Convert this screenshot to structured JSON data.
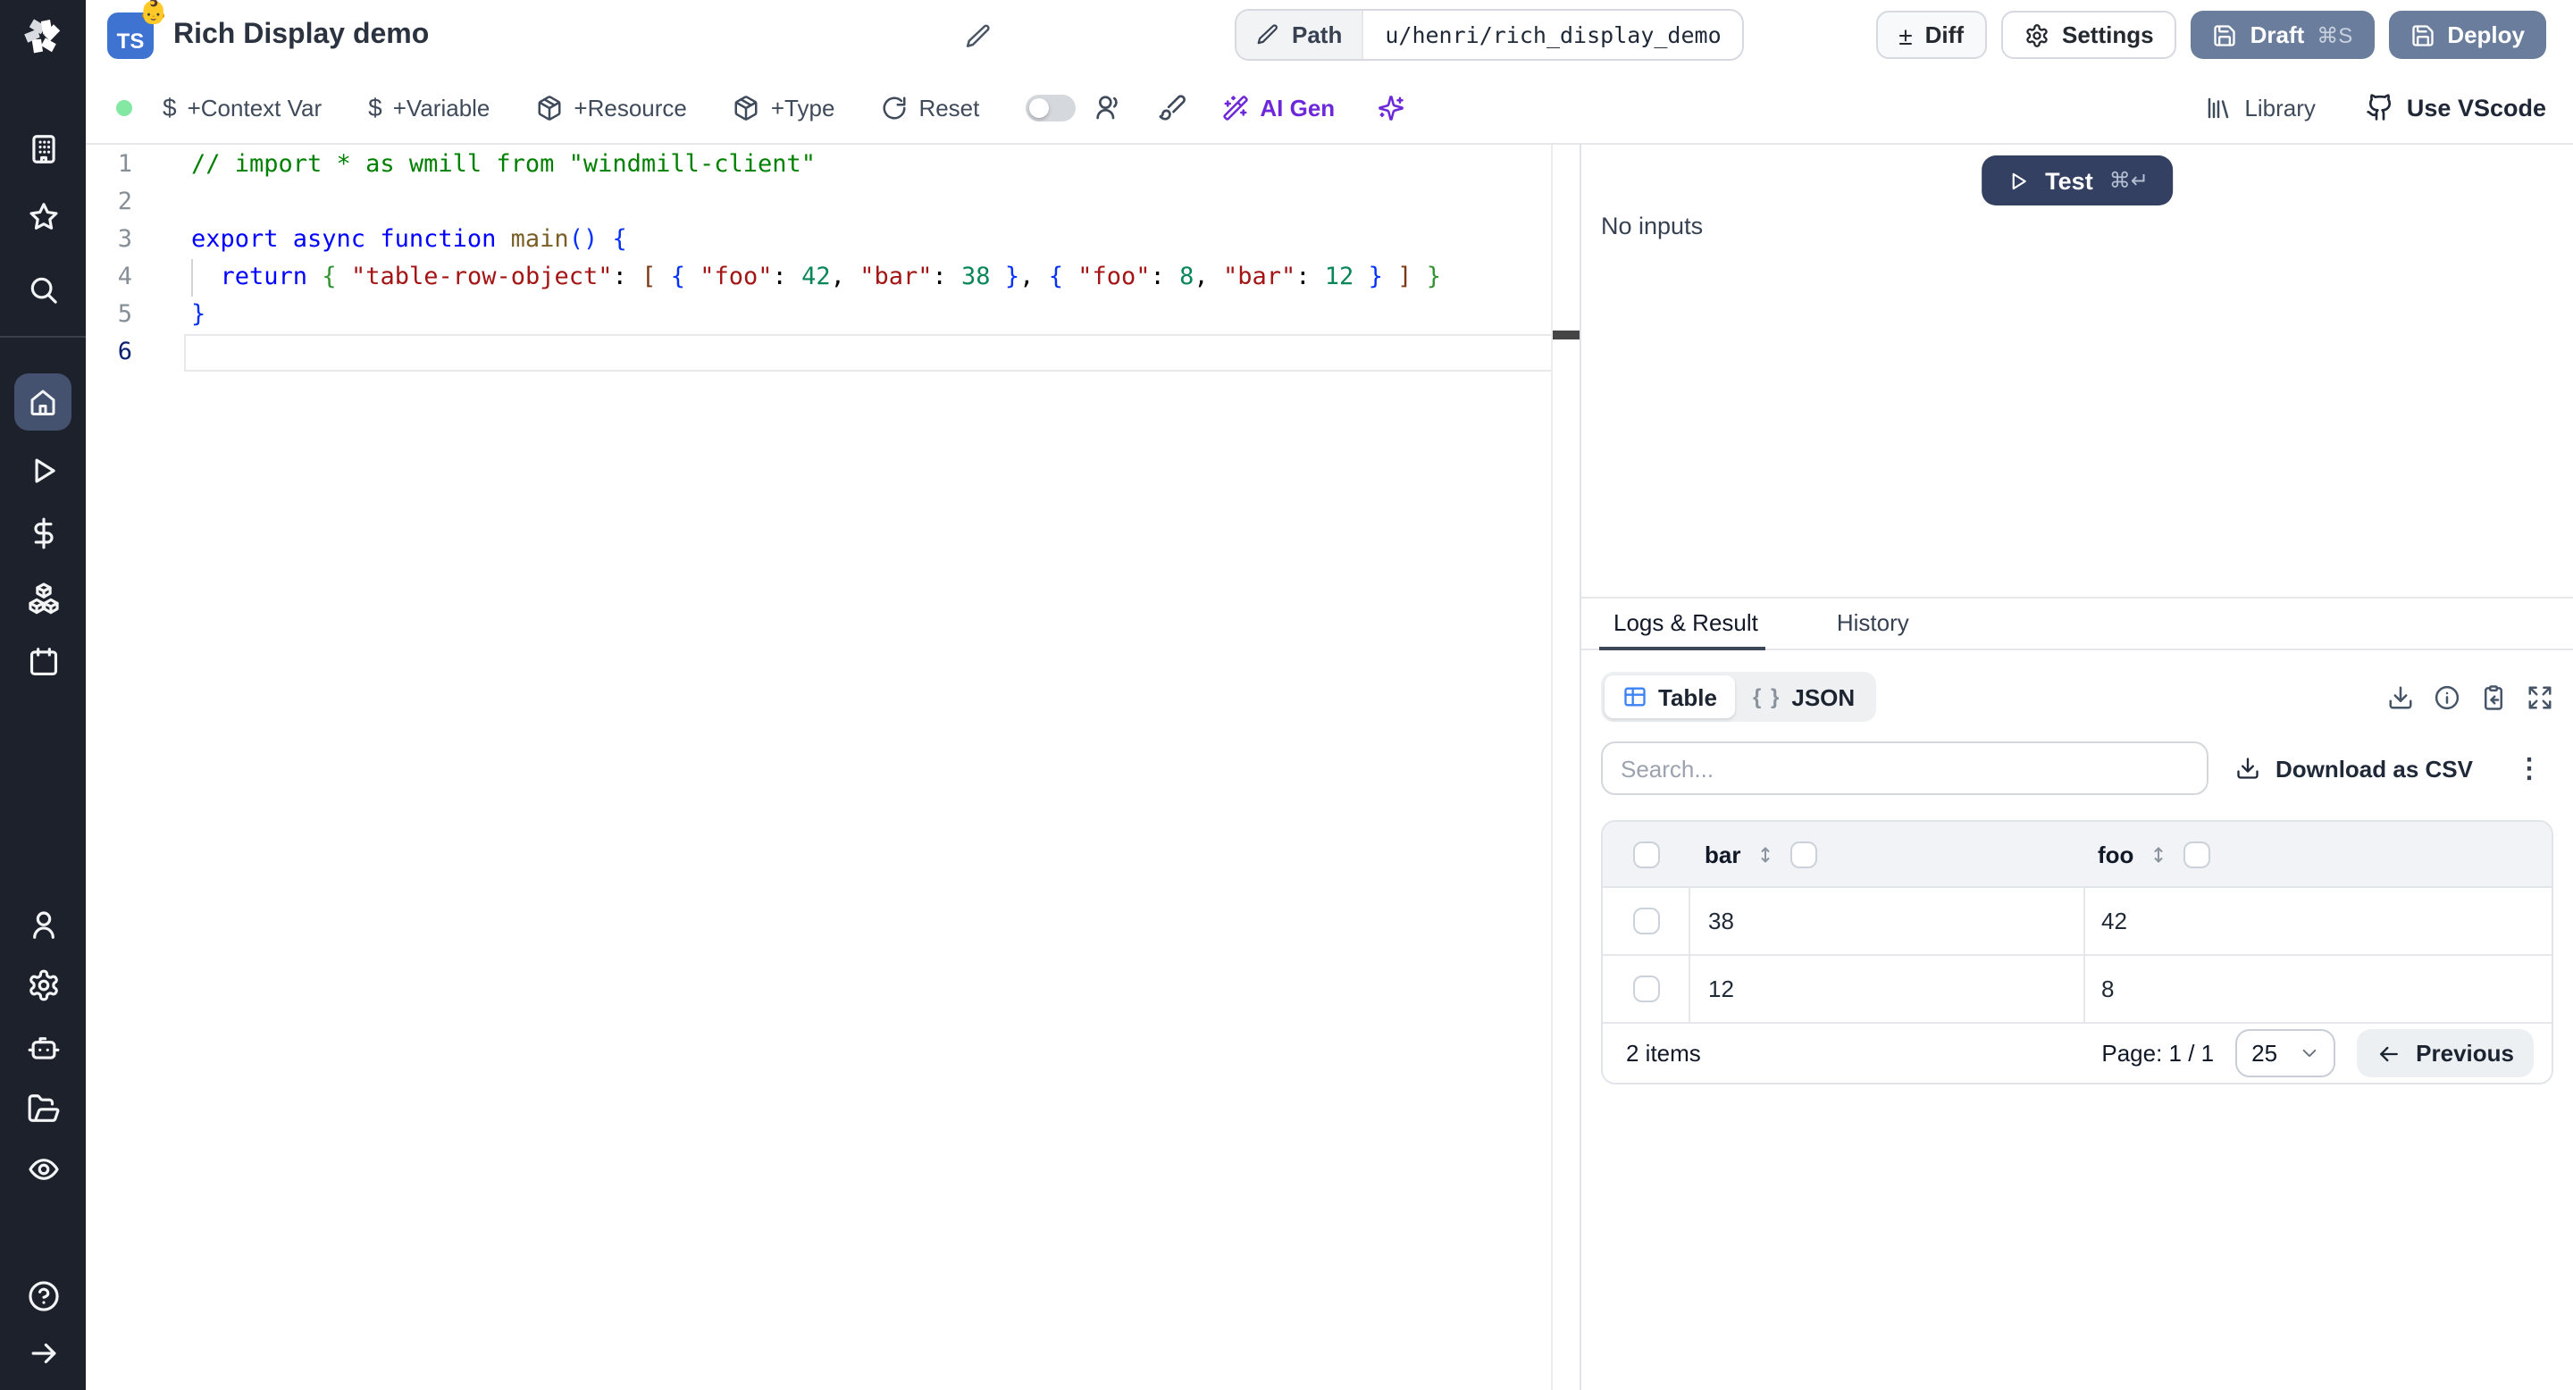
{
  "app": {
    "name": "Windmill script editor"
  },
  "colors": {
    "accent_blue": "#3b82f6",
    "slate_button": "#6b7d9c",
    "test_button": "#344061",
    "status_green": "#83e8a2",
    "ai_purple": "#6d28d9",
    "ts_badge_blue": "#3f73d1",
    "sidebar_bg": "#1c212b",
    "active_item_bg": "#45526f"
  },
  "sidebar": {
    "logo_icon": "windmill-logo",
    "top_icons": [
      "building-icon",
      "star-icon",
      "search-icon"
    ],
    "main_icons": [
      "home-icon",
      "play-icon",
      "dollar-icon",
      "cubes-icon",
      "calendar-icon"
    ],
    "active_icon": "home-icon",
    "lower_icons": [
      "user-icon",
      "gear-icon",
      "robot-icon",
      "folder-open-icon",
      "eye-icon"
    ],
    "bottom_icons": [
      "help-circle-icon",
      "arrow-right-icon"
    ]
  },
  "header": {
    "language_badge": "TS",
    "badge_emoji": "👶",
    "title": "Rich Display demo",
    "path_label": "Path",
    "path_value": "u/henri/rich_display_demo",
    "diff_icon": "±",
    "diff_label": "Diff",
    "settings_label": "Settings",
    "draft_label": "Draft",
    "draft_shortcut": "⌘S",
    "deploy_label": "Deploy"
  },
  "toolbar": {
    "dollar_icon": "$",
    "context_var_label": "+Context Var",
    "variable_label": "+Variable",
    "resource_label": "+Resource",
    "type_label": "+Type",
    "reset_label": "Reset",
    "ai_gen_label": "AI Gen",
    "library_label": "Library",
    "use_vscode_label": "Use VScode"
  },
  "editor": {
    "lines": [
      {
        "number": "1",
        "tokens": [
          [
            "cm",
            "// import * as wmill from \"windmill-client\""
          ]
        ]
      },
      {
        "number": "2",
        "tokens": []
      },
      {
        "number": "3",
        "tokens": [
          [
            "kw",
            "export async function"
          ],
          [
            "pl",
            " "
          ],
          [
            "fn",
            "main"
          ],
          [
            "b1",
            "()"
          ],
          [
            "pl",
            " "
          ],
          [
            "b1",
            "{"
          ]
        ]
      },
      {
        "number": "4",
        "tokens": [
          [
            "pl",
            "  "
          ],
          [
            "kw",
            "return"
          ],
          [
            "pl",
            " "
          ],
          [
            "b2",
            "{"
          ],
          [
            "pl",
            " "
          ],
          [
            "st",
            "\"table-row-object\""
          ],
          [
            "pu",
            ":"
          ],
          [
            "pl",
            " "
          ],
          [
            "b3",
            "["
          ],
          [
            "pl",
            " "
          ],
          [
            "b1",
            "{"
          ],
          [
            "pl",
            " "
          ],
          [
            "st",
            "\"foo\""
          ],
          [
            "pu",
            ":"
          ],
          [
            "pl",
            " "
          ],
          [
            "nu",
            "42"
          ],
          [
            "pu",
            ","
          ],
          [
            "pl",
            " "
          ],
          [
            "st",
            "\"bar\""
          ],
          [
            "pu",
            ":"
          ],
          [
            "pl",
            " "
          ],
          [
            "nu",
            "38"
          ],
          [
            "pl",
            " "
          ],
          [
            "b1",
            "}"
          ],
          [
            "pu",
            ","
          ],
          [
            "pl",
            " "
          ],
          [
            "b1",
            "{"
          ],
          [
            "pl",
            " "
          ],
          [
            "st",
            "\"foo\""
          ],
          [
            "pu",
            ":"
          ],
          [
            "pl",
            " "
          ],
          [
            "nu",
            "8"
          ],
          [
            "pu",
            ","
          ],
          [
            "pl",
            " "
          ],
          [
            "st",
            "\"bar\""
          ],
          [
            "pu",
            ":"
          ],
          [
            "pl",
            " "
          ],
          [
            "nu",
            "12"
          ],
          [
            "pl",
            " "
          ],
          [
            "b1",
            "}"
          ],
          [
            "pl",
            " "
          ],
          [
            "b3",
            "]"
          ],
          [
            "pl",
            " "
          ],
          [
            "b2",
            "}"
          ]
        ]
      },
      {
        "number": "5",
        "tokens": [
          [
            "b1",
            "}"
          ]
        ]
      },
      {
        "number": "6",
        "tokens": [],
        "active": true
      }
    ]
  },
  "panel": {
    "test_label": "Test",
    "test_shortcut": "⌘↵",
    "no_inputs": "No inputs",
    "tabs": [
      {
        "label": "Logs & Result",
        "active": true
      },
      {
        "label": "History",
        "active": false
      }
    ],
    "view_toggle": {
      "table_label": "Table",
      "json_label": "JSON",
      "braces_glyph": "{ }"
    },
    "action_icons": [
      "download-icon",
      "info-icon",
      "clipboard-paste-icon",
      "expand-icon"
    ],
    "search_placeholder": "Search...",
    "download_csv_label": "Download as CSV",
    "kebab_icon": "⋮",
    "table": {
      "columns": [
        {
          "label": "bar"
        },
        {
          "label": "foo"
        }
      ],
      "rows": [
        [
          "38",
          "42"
        ],
        [
          "12",
          "8"
        ]
      ],
      "items_count": "2 items",
      "page_label": "Page: 1 / 1",
      "page_size": "25",
      "previous_label": "Previous"
    }
  }
}
